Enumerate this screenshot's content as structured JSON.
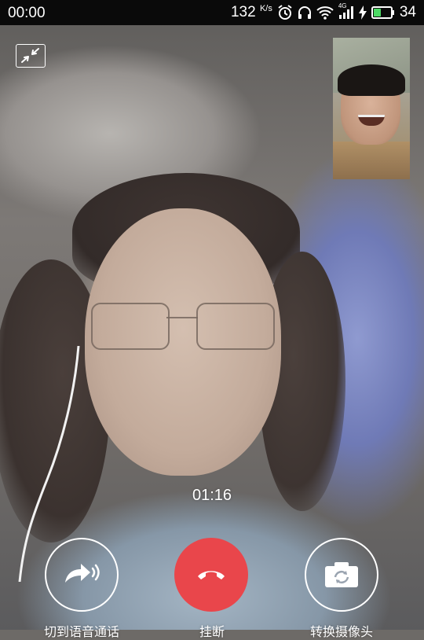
{
  "status_bar": {
    "time": "00:00",
    "net_speed": "132",
    "net_speed_unit": "K/s",
    "network_type": "4G",
    "battery_level": "34",
    "icons": [
      "alarm-icon",
      "headphones-icon",
      "wifi-icon",
      "signal-icon",
      "charging-icon",
      "battery-icon"
    ]
  },
  "call": {
    "duration": "01:16",
    "controls": {
      "voice_label": "切到语音通话",
      "hangup_label": "挂断",
      "camera_label": "转换摄像头"
    }
  },
  "colors": {
    "hangup": "#e9464b",
    "battery_fill": "#4cd964"
  }
}
